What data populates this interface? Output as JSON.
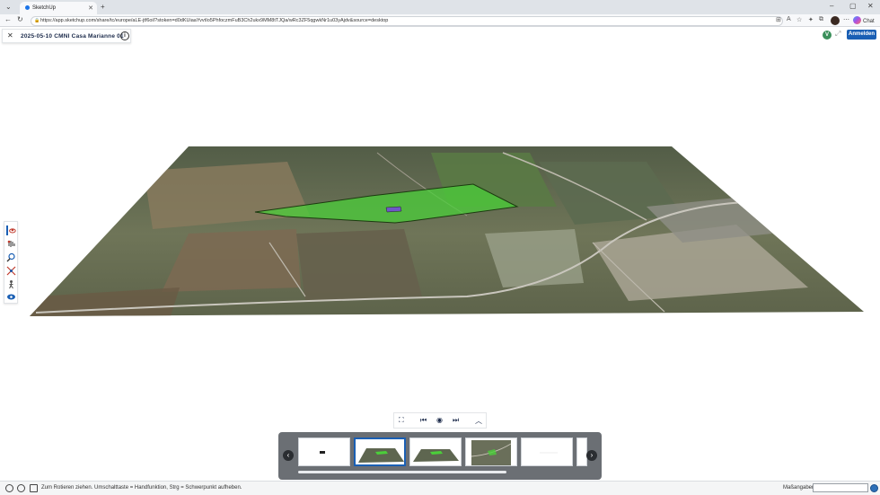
{
  "browser": {
    "tab_title": "SketchUp",
    "url": "https://app.sketchup.com/share/tc/europe/aLE-jtf6oiI?stoken=d0dKUiaaYvvtIo5PhfoczmFuB3Ch2ukx9MM8tTJQa/wRc3ZF5qgwkNr1u03yAjdv&source=desktop",
    "copilot_label": "Chat"
  },
  "app": {
    "model_title": "2025-05-10 CMNI Casa Marianne 01",
    "version_badge": "V",
    "signin_label": "Anmelden"
  },
  "status": {
    "hint": "Zum Rotieren ziehen. Umschalttaste = Handfunktion, Strg = Schwerpunkt aufheben.",
    "measurements_label": "Maßangaben",
    "measurements_value": ""
  },
  "colors": {
    "accent": "#1a5fb4",
    "scene_panel": "#6b6f74",
    "parcel_green": "#4bcf3a"
  },
  "icons": {
    "toolbar": [
      "orbit-icon",
      "pan-icon",
      "zoom-icon",
      "zoom-extents-icon",
      "walk-icon",
      "look-around-icon"
    ],
    "playback": [
      "fullscreen-icon",
      "previous-scene-icon",
      "play-icon",
      "next-scene-icon",
      "collapse-icon"
    ]
  }
}
